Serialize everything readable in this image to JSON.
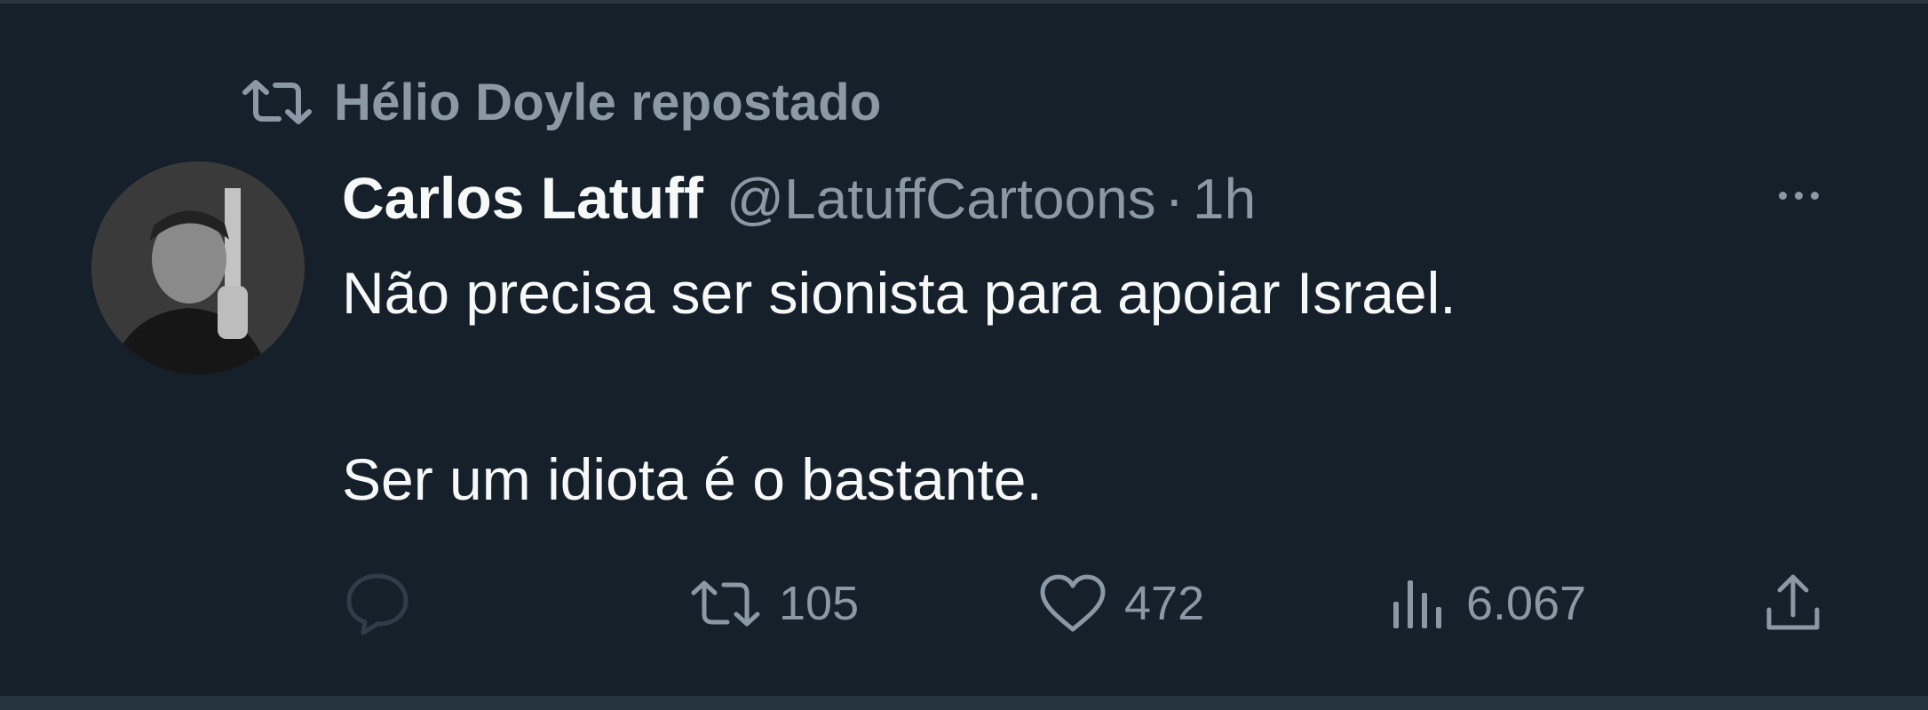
{
  "repost": {
    "icon": "repost-icon",
    "label": "Hélio Doyle repostado"
  },
  "tweet": {
    "author_name": "Carlos Latuff",
    "handle": "@LatuffCartoons",
    "separator": "·",
    "time": "1h",
    "more_icon": "more-horizontal-icon",
    "lines": [
      "Não precisa ser sionista para apoiar Israel.",
      "Ser um idiota é o bastante."
    ]
  },
  "actions": {
    "reply": {
      "icon": "reply-icon"
    },
    "repost": {
      "icon": "repost-icon",
      "count": "105"
    },
    "like": {
      "icon": "heart-icon",
      "count": "472"
    },
    "views": {
      "icon": "views-icon",
      "count": "6.067"
    },
    "share": {
      "icon": "share-icon"
    }
  },
  "colors": {
    "background": "#15202b",
    "primary_text": "#f7f9f9",
    "secondary_text": "#8b98a5"
  }
}
